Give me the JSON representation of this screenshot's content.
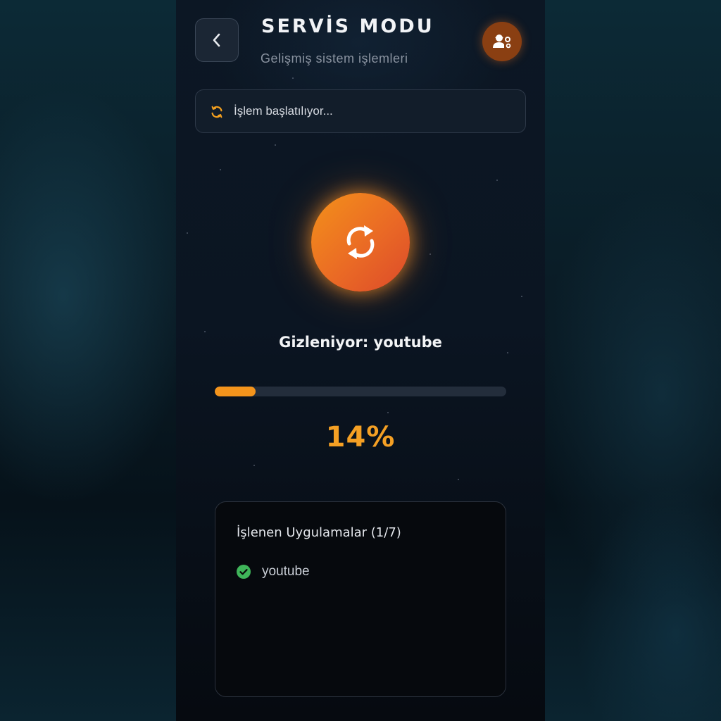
{
  "header": {
    "title": "SERVİS MODU",
    "subtitle": "Gelişmiş sistem işlemleri",
    "back_icon": "chevron-left-icon",
    "service_icon": "user-gear-icon"
  },
  "status": {
    "text": "İşlem başlatılıyor...",
    "icon": "sync-icon"
  },
  "progress": {
    "label": "Gizleniyor: youtube",
    "percent_text": "14%",
    "value": 0.14
  },
  "apps_card": {
    "title": "İşlenen Uygulamalar (1/7)",
    "items": [
      {
        "name": "youtube",
        "icon": "check-circle-icon"
      }
    ]
  },
  "colors": {
    "accent": "#f4941c",
    "success": "#3fb55a",
    "background": "#0b1522"
  }
}
